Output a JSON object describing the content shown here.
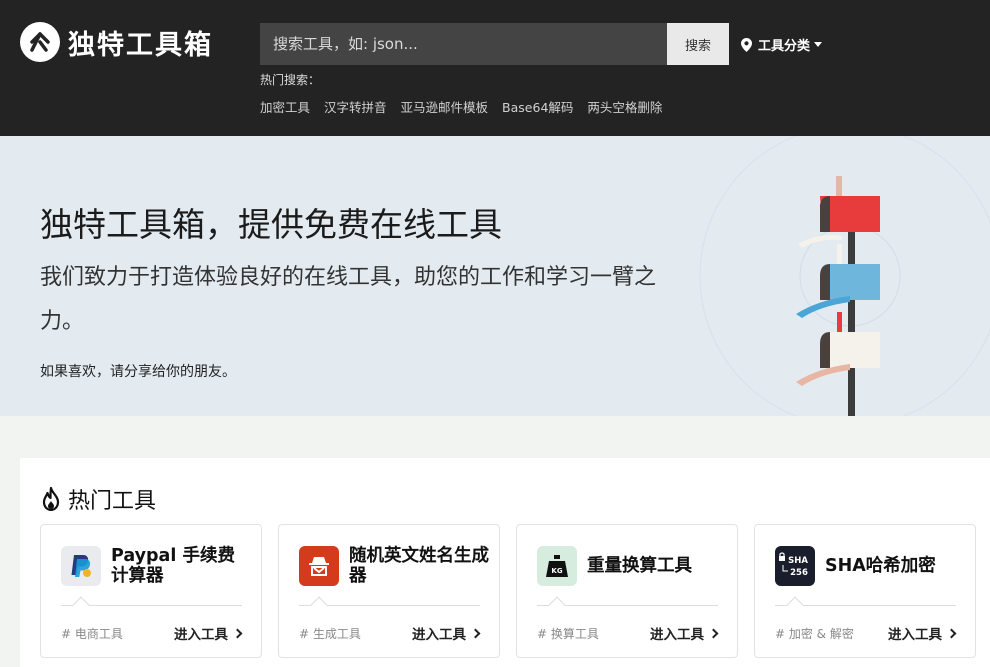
{
  "brand": {
    "name": "独特工具箱"
  },
  "search": {
    "placeholder": "搜索工具，如: json...",
    "button_label": "搜索"
  },
  "categories_label": "工具分类",
  "hot_search": {
    "label": "热门搜索：",
    "links": [
      "加密工具",
      "汉字转拼音",
      "亚马逊邮件模板",
      "Base64解码",
      "两头空格删除"
    ]
  },
  "hero": {
    "title": "独特工具箱，提供免费在线工具",
    "subtitle": "我们致力于打造体验良好的在线工具，助您的工作和学习一臂之力。",
    "share": "如果喜欢，请分享给你的朋友。"
  },
  "hot_tools": {
    "title": "热门工具",
    "cards": [
      {
        "name": "Paypal 手续费计算器",
        "tag": "# 电商工具",
        "link": "进入工具",
        "icon": "paypal-icon",
        "icon_bg": "#e9ebee"
      },
      {
        "name": "随机英文姓名生成器",
        "tag": "# 生成工具",
        "link": "进入工具",
        "icon": "spy-icon",
        "icon_bg": "#d43a1c"
      },
      {
        "name": "重量换算工具",
        "tag": "# 换算工具",
        "link": "进入工具",
        "icon": "weight-icon",
        "icon_bg": "#d6ecdf",
        "icon_text": "KG"
      },
      {
        "name": "SHA哈希加密",
        "tag": "# 加密 & 解密",
        "link": "进入工具",
        "icon": "sha256-icon",
        "icon_bg": "#1a1d2b",
        "icon_text_top": "SHA",
        "icon_text_bottom": "256"
      }
    ]
  },
  "colors": {
    "header_bg": "#232323",
    "hero_bg": "#e3ebf1",
    "page_bg": "#f2f4f1",
    "mailbox_red": "#e83b3b",
    "mailbox_blue": "#6fb6dd"
  }
}
